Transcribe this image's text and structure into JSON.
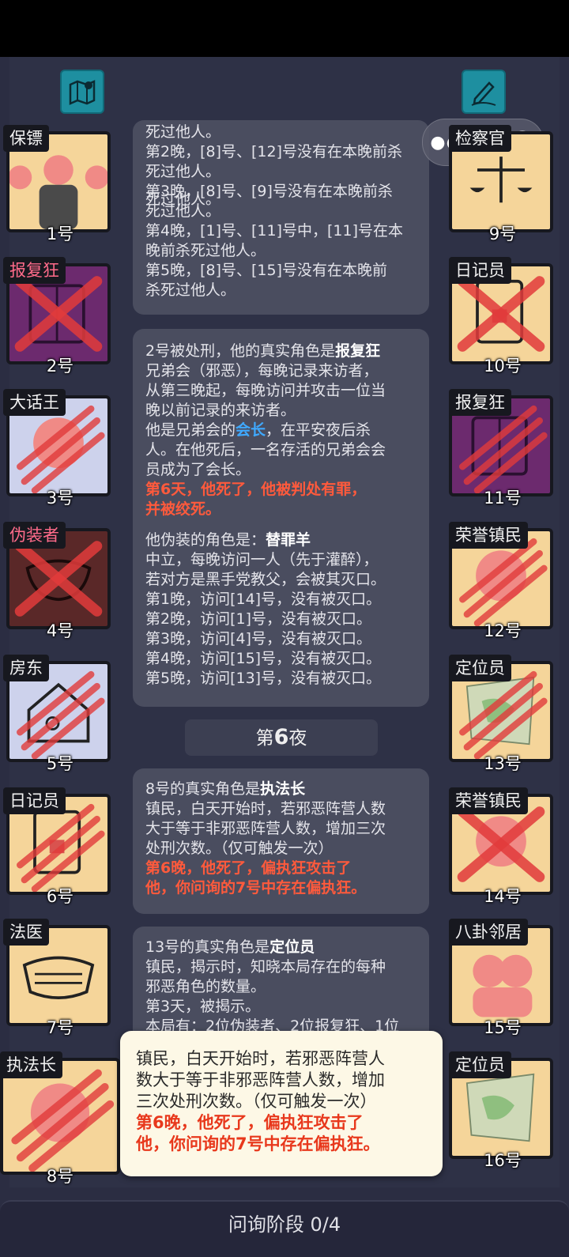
{
  "capsule": {
    "menu_icon": "more-dots-icon",
    "close_icon": "record-close-icon"
  },
  "left_cards": [
    {
      "role": "保镖",
      "num": "1号",
      "status": "alive",
      "role_color": "#f2f2f2"
    },
    {
      "role": "报复狂",
      "num": "2号",
      "status": "executed",
      "role_color": "#ff6b8a"
    },
    {
      "role": "大话王",
      "num": "3号",
      "status": "killed",
      "role_color": "#f2f2f2"
    },
    {
      "role": "伪装者",
      "num": "4号",
      "status": "executed",
      "role_color": "#ff6b8a"
    },
    {
      "role": "房东",
      "num": "5号",
      "status": "killed",
      "role_color": "#f2f2f2"
    },
    {
      "role": "日记员",
      "num": "6号",
      "status": "killed",
      "role_color": "#f2f2f2"
    },
    {
      "role": "法医",
      "num": "7号",
      "status": "alive",
      "role_color": "#f2f2f2"
    },
    {
      "role": "执法长",
      "num": "8号",
      "status": "killed",
      "role_color": "#f2f2f2"
    }
  ],
  "right_cards": [
    {
      "role": "检察官",
      "num": "9号",
      "status": "alive"
    },
    {
      "role": "日记员",
      "num": "10号",
      "status": "executed"
    },
    {
      "role": "报复狂",
      "num": "11号",
      "status": "killed"
    },
    {
      "role": "荣誉镇民",
      "num": "12号",
      "status": "killed"
    },
    {
      "role": "定位员",
      "num": "13号",
      "status": "killed"
    },
    {
      "role": "荣誉镇民",
      "num": "14号",
      "status": "executed"
    },
    {
      "role": "八卦邻居",
      "num": "15号",
      "status": "alive"
    },
    {
      "role": "定位员",
      "num": "16号",
      "status": "alive"
    }
  ],
  "log": {
    "msg1": [
      "死过他人。",
      "第2晚，[8]号、[12]号没有在本晚前杀",
      "死过他人。",
      "第3晚，[8]号、[9]号没有在本晚前杀",
      "死过他人。",
      "第4晚，[1]号、[11]号中，[11]号在本",
      "晚前杀死过他人。",
      "第5晚，[8]号、[15]号没有在本晚前",
      "杀死过他人。"
    ],
    "msg2": {
      "l1a": "2号被处刑，他的真实角色是",
      "l1b": "报复狂",
      "l2": "兄弟会（邪恶），每晚记录来访者，",
      "l3": "从第三晚起，每晚访问并攻击一位当",
      "l4": "晚以前记录的来访者。",
      "l5a": "他是兄弟会的",
      "l5b": "会长",
      "l5c": "，在平安夜后杀",
      "l6": "人。在他死后，一名存活的兄弟会会",
      "l7": "员成为了会长。",
      "l8": "第6天，他死了，他被判处有罪，",
      "l9": "并被绞死。",
      "l10a": "他伪装的角色是：",
      "l10b": "替罪羊",
      "l11": "中立，每晚访问一人（先于灌醉），",
      "l12": "若对方是黑手党教父，会被其灭口。",
      "l13": "第1晚，访问[14]号，没有被灭口。",
      "l14": "第2晚，访问[1]号，没有被灭口。",
      "l15": "第3晚，访问[4]号，没有被灭口。",
      "l16": "第4晚，访问[15]号，没有被灭口。",
      "l17": "第5晚，访问[13]号，没有被灭口。"
    },
    "night": {
      "pre": "第",
      "num": "6",
      "post": "夜"
    },
    "msg3": {
      "l1a": "8号的真实角色是",
      "l1b": "执法长",
      "l2": "镇民，白天开始时，若邪恶阵营人数",
      "l3": "大于等于非邪恶阵营人数，增加三次",
      "l4": "处刑次数。（仅可触发一次）",
      "l5": "第6晚，他死了，偏执狂攻击了",
      "l6": "他，你问询的7号中存在偏执狂。"
    },
    "msg4": {
      "l1a": "13号的真实角色是",
      "l1b": "定位员",
      "l2": "镇民，揭示时，知晓本局存在的每种",
      "l3": "邪恶角色的数量。",
      "l4": "第3天，被揭示。",
      "l5": "本局有：2位伪装者、2位报复狂、1位"
    }
  },
  "popup": {
    "l1": "镇民，白天开始时，若邪恶阵营人",
    "l2": "数大于等于非邪恶阵营人数，增加",
    "l3": "三次处刑次数。（仅可触发一次）",
    "l4": "第6晚，他死了，偏执狂攻击了",
    "l5": "他，你问询的7号中存在偏执狂。"
  },
  "bottom": {
    "phase": "问询阶段 0/4"
  },
  "colors": {
    "bg": "#2b2d42",
    "card_peach": "#f5d59a",
    "accent_red": "#ff5a3c",
    "blue": "#3fa9ff",
    "tool_button": "#1e8fa0"
  }
}
